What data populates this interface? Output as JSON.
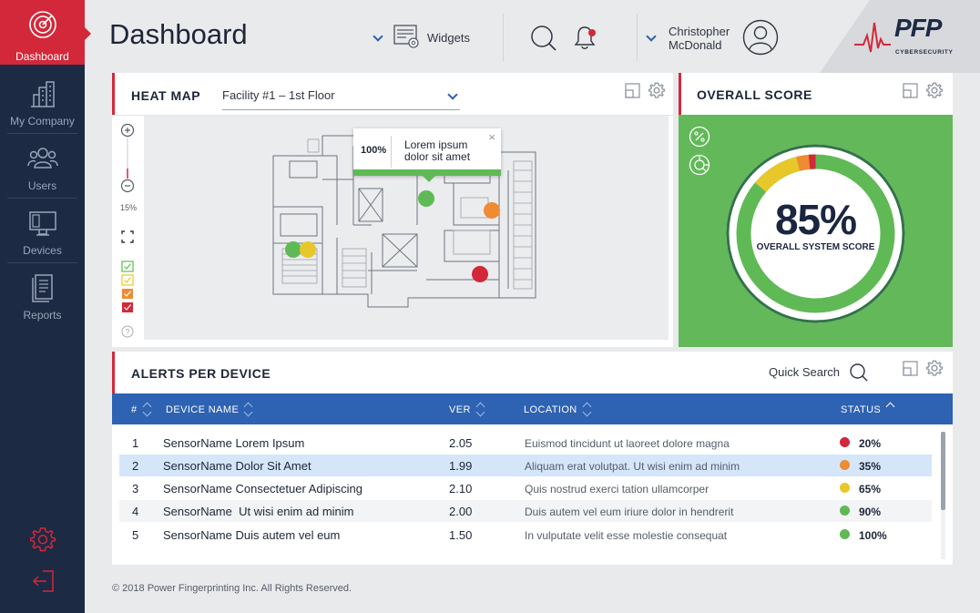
{
  "sidebar": {
    "items": [
      {
        "label": "Dashboard",
        "icon": "radar-icon"
      },
      {
        "label": "My Company",
        "icon": "building-icon"
      },
      {
        "label": "Users",
        "icon": "users-icon"
      },
      {
        "label": "Devices",
        "icon": "monitor-icon"
      },
      {
        "label": "Reports",
        "icon": "report-icon"
      }
    ],
    "bottom_icons": [
      "gear-icon",
      "logout-icon"
    ]
  },
  "header": {
    "title": "Dashboard",
    "widgets_label": "Widgets",
    "user_first": "Christopher",
    "user_last": "McDonald",
    "logo_text": "PFP",
    "logo_sub": "CYBERSECURITY"
  },
  "heatmap": {
    "title": "HEAT MAP",
    "facility": "Facility #1 – 1st Floor",
    "zoom": "15%",
    "tooltip_pct": "100%",
    "tooltip_msg": "Lorem ipsum dolor sit amet"
  },
  "score": {
    "title": "OVERALL SCORE",
    "value": "85%",
    "label": "OVERALL SYSTEM SCORE"
  },
  "alerts": {
    "title": "ALERTS PER DEVICE",
    "quick_search": "Quick Search",
    "columns": [
      "#",
      "DEVICE NAME",
      "VER",
      "LOCATION",
      "STATUS"
    ],
    "rows": [
      {
        "num": "1",
        "name": "SensorName Lorem Ipsum",
        "ver": "2.05",
        "location": "Euismod tincidunt ut laoreet dolore magna",
        "status": "20%",
        "color": "#d3283a"
      },
      {
        "num": "2",
        "name": "SensorName Dolor Sit Amet",
        "ver": "1.99",
        "location": "Aliquam erat volutpat. Ut wisi enim ad minim",
        "status": "35%",
        "color": "#ef8b32"
      },
      {
        "num": "3",
        "name": "SensorName Consectetuer Adipiscing",
        "ver": "2.10",
        "location": "Quis nostrud exerci tation ullamcorper",
        "status": "65%",
        "color": "#e8c72a"
      },
      {
        "num": "4",
        "name": "SensorName  Ut wisi enim ad minim",
        "ver": "2.00",
        "location": "Duis autem vel eum iriure dolor in hendrerit",
        "status": "90%",
        "color": "#5fba55"
      },
      {
        "num": "5",
        "name": "SensorName Duis autem vel eum",
        "ver": "1.50",
        "location": "In vulputate velit esse molestie consequat",
        "status": "100%",
        "color": "#5fba55"
      }
    ]
  },
  "footer": "© 2018 Power Fingerprinting Inc. All Rights Reserved.",
  "colors": {
    "accent": "#d3283a",
    "sidebar": "#1c2a44",
    "header_blue": "#2e62b2",
    "green": "#63b85a"
  }
}
